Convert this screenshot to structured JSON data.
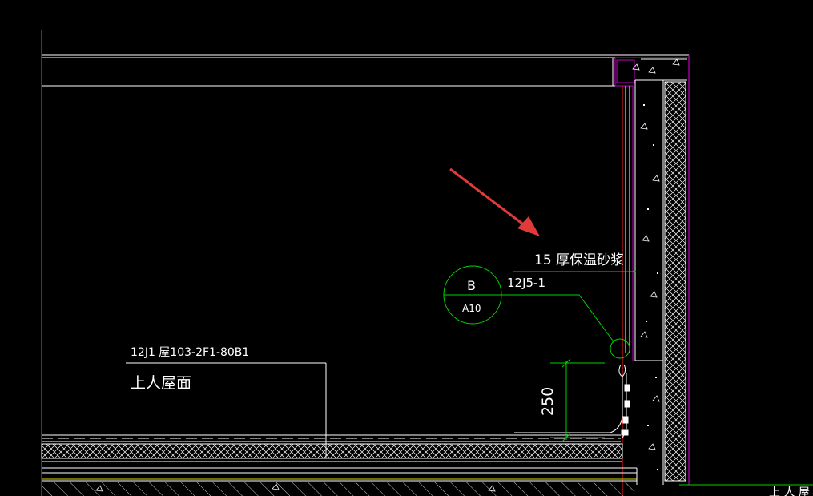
{
  "drawing": {
    "callout_material": "15  厚保温砂浆",
    "callout_ref": "12J5-1",
    "detail_bubble": {
      "letter": "B",
      "sheet": "A10"
    },
    "roof_ref": "12J1    屋103-2F1-80B1",
    "roof_name": "上人屋面",
    "dimension_250": "250",
    "bottom_right_label": "上 人 屋"
  },
  "colors": {
    "background": "#000000",
    "white_line": "#ffffff",
    "green_line": "#00d400",
    "magenta_line": "#c000c0",
    "red_line": "#ff2020",
    "arrow": "#e03a3a",
    "yellow_line": "#d8d800"
  }
}
